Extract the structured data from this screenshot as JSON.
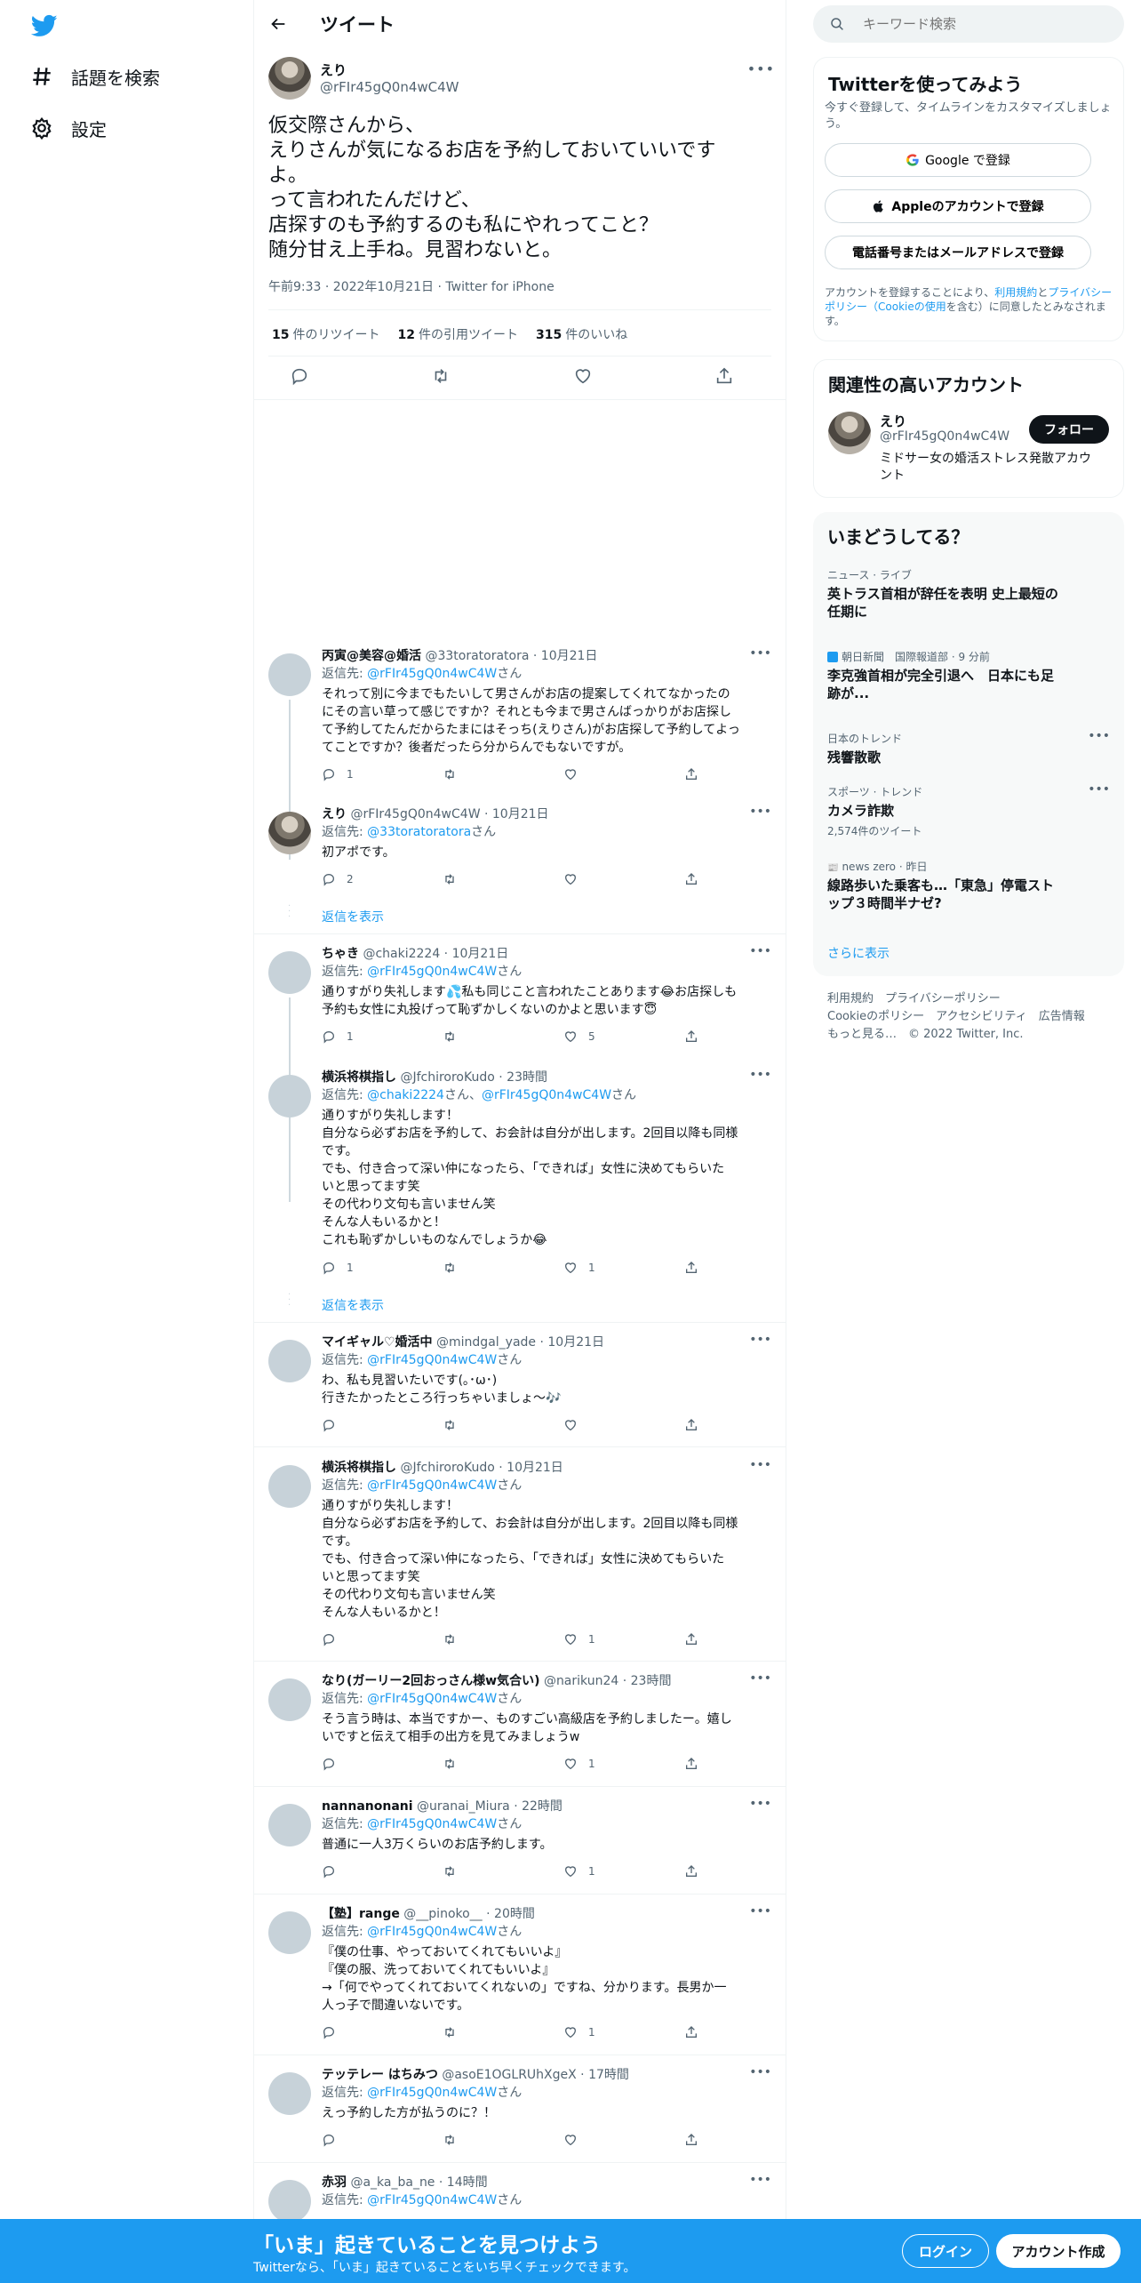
{
  "nav": {
    "explore": "話題を検索",
    "settings": "設定"
  },
  "header": {
    "title": "ツイート"
  },
  "main_tweet": {
    "name": "えり",
    "handle": "@rFIr45gQ0n4wC4W",
    "text": "仮交際さんから、\nえりさんが気になるお店を予約しておいていいです\nよ。\nって言われたんだけど、\n店探すのも予約するのも私にやれってこと？\n随分甘え上手ね。見習わないと。",
    "meta": "午前9:33 · 2022年10月21日 · Twitter for iPhone",
    "stats": [
      {
        "count": "15",
        "label": "件のリツイート"
      },
      {
        "count": "12",
        "label": "件の引用ツイート"
      },
      {
        "count": "315",
        "label": "件のいいね"
      }
    ]
  },
  "replies": [
    {
      "name": "丙寅@美容@婚活",
      "handle": "@33toratoratora",
      "time": "10月21日",
      "to_prefix": "返信先: ",
      "to": "@rFIr45gQ0n4wC4W",
      "to_suffix": "さん",
      "text": "それって別に今までもたいして男さんがお店の提案してくれてなかったの\nにその言い草って感じですか？それとも今まで男さんばっかりがお店探し\nて予約してたんだからたまにはそっち(えりさん)がお店探して予約してよっ\nてことですか？後者だったら分からんでもないですが。",
      "reply": "1",
      "rt": "",
      "like": ""
    },
    {
      "name": "えり",
      "handle": "@rFIr45gQ0n4wC4W",
      "time": "10月21日",
      "to_prefix": "返信先: ",
      "to": "@33toratoratora",
      "to_suffix": "さん",
      "text": "初アポです。",
      "reply": "2",
      "rt": "",
      "like": ""
    },
    {
      "name": "ちゃき",
      "handle": "@chaki2224",
      "time": "10月21日",
      "to_prefix": "返信先: ",
      "to": "@rFIr45gQ0n4wC4W",
      "to_suffix": "さん",
      "text": "通りすがり失礼します💦私も同じこと言われたことあります😂お店探しも\n予約も女性に丸投げって恥ずかしくないのかよと思います😇",
      "reply": "1",
      "rt": "",
      "like": "5"
    },
    {
      "name": "横浜将棋指し",
      "handle": "@JfchiroroKudo",
      "time": "23時間",
      "to_prefix": "返信先: ",
      "to": "@chaki2224",
      "to_mid": "さん、",
      "to2": "@rFIr45gQ0n4wC4W",
      "to_suffix": "さん",
      "text": "通りすがり失礼します！\n自分なら必ずお店を予約して、お会計は自分が出します。2回目以降も同様\nです。\nでも、付き合って深い仲になったら、「できれば」女性に決めてもらいた\nいと思ってます笑\nその代わり文句も言いません笑\nそんな人もいるかと！\nこれも恥ずかしいものなんでしょうか😂",
      "reply": "1",
      "rt": "",
      "like": "1"
    },
    {
      "name": "マイギャル♡婚活中",
      "handle": "@mindgal_yade",
      "time": "10月21日",
      "to_prefix": "返信先: ",
      "to": "@rFIr45gQ0n4wC4W",
      "to_suffix": "さん",
      "text": "わ、私も見習いたいです(｡･ω･)\n行きたかったところ行っちゃいましょ〜🎶",
      "reply": "",
      "rt": "",
      "like": ""
    },
    {
      "name": "横浜将棋指し",
      "handle": "@JfchiroroKudo",
      "time": "10月21日",
      "to_prefix": "返信先: ",
      "to": "@rFIr45gQ0n4wC4W",
      "to_suffix": "さん",
      "text": "通りすがり失礼します！\n自分なら必ずお店を予約して、お会計は自分が出します。2回目以降も同様\nです。\nでも、付き合って深い仲になったら、「できれば」女性に決めてもらいた\nいと思ってます笑\nその代わり文句も言いません笑\nそんな人もいるかと！",
      "reply": "",
      "rt": "",
      "like": "1"
    },
    {
      "name": "なり(ガーリー2回おっさん様w気合い)",
      "handle": "@narikun24",
      "time": "23時間",
      "to_prefix": "返信先: ",
      "to": "@rFIr45gQ0n4wC4W",
      "to_suffix": "さん",
      "text": "そう言う時は、本当ですかー、ものすごい高級店を予約しましたー。嬉し\nいですと伝えて相手の出方を見てみましょうw",
      "reply": "",
      "rt": "",
      "like": "1"
    },
    {
      "name": "nannanonani",
      "handle": "@uranai_Miura",
      "time": "22時間",
      "to_prefix": "返信先: ",
      "to": "@rFIr45gQ0n4wC4W",
      "to_suffix": "さん",
      "text": "普通に一人3万くらいのお店予約します。",
      "reply": "",
      "rt": "",
      "like": "1"
    },
    {
      "name": "【塾】range",
      "handle": "@__pinoko__",
      "time": "20時間",
      "to_prefix": "返信先: ",
      "to": "@rFIr45gQ0n4wC4W",
      "to_suffix": "さん",
      "text": "『僕の仕事、やっておいてくれてもいいよ』\n『僕の服、洗っておいてくれてもいいよ』\n→「何でやってくれておいてくれないの」ですね、分かります。長男か一\n人っ子で間違いないです。",
      "reply": "",
      "rt": "",
      "like": "1"
    },
    {
      "name": "テッテレー はちみつ",
      "handle": "@asoE1OGLRUhXgeX",
      "time": "17時間",
      "to_prefix": "返信先: ",
      "to": "@rFIr45gQ0n4wC4W",
      "to_suffix": "さん",
      "text": "えっ予約した方が払うのに？！",
      "reply": "",
      "rt": "",
      "like": ""
    },
    {
      "name": "赤羽",
      "handle": "@a_ka_ba_ne",
      "time": "14時間",
      "to_prefix": "返信先: ",
      "to": "@rFIr45gQ0n4wC4W",
      "to_suffix": "さん",
      "text": "",
      "reply": "",
      "rt": "",
      "like": ""
    }
  ],
  "show_replies": "返信を表示",
  "search": {
    "placeholder": "キーワード検索"
  },
  "signup_card": {
    "title": "Twitterを使ってみよう",
    "subtitle": "今すぐ登録して、タイムラインをカスタマイズしましょう。",
    "google": "Google で登録",
    "apple": "Appleのアカウントで登録",
    "phone": "電話番号またはメールアドレスで登録",
    "legal_1": "アカウントを登録することにより、",
    "legal_terms": "利用規約",
    "legal_and": "と",
    "legal_privacy": "プライバシーポリシー（Cookieの使用",
    "legal_2": "を含む）に同意したとみなされます。"
  },
  "related": {
    "title": "関連性の高いアカウント",
    "name": "えり",
    "handle": "@rFIr45gQ0n4wC4W",
    "follow": "フォロー",
    "bio": "ミドサー女の婚活ストレス発散アカウ\nント"
  },
  "trends": {
    "title": "いまどうしてる？",
    "items": [
      {
        "cat": "ニュース · ライブ",
        "title": "英トラス首相が辞任を表明 史上最短の任期に",
        "sub": ""
      },
      {
        "cat": "朝日新聞　国際報道部 · 9 分前",
        "title": "李克強首相が完全引退へ　日本にも足跡が...",
        "sub": ""
      },
      {
        "cat": "日本のトレンド",
        "title": "残響散歌",
        "sub": ""
      },
      {
        "cat": "スポーツ · トレンド",
        "title": "カメラ詐欺",
        "sub": "2,574件のツイート"
      },
      {
        "cat": "news zero · 昨日",
        "title": "線路歩いた乗客も…「東急」停電ストップ３時間半ナゼ?",
        "sub": ""
      }
    ],
    "show_more": "さらに表示"
  },
  "footer": {
    "line1": "利用規約　プライバシーポリシー",
    "line2": "Cookieのポリシー　アクセシビリティ　広告情報",
    "line3": "もっと見る…　© 2022 Twitter, Inc."
  },
  "banner": {
    "title": "「いま」起きていることを見つけよう",
    "subtitle": "Twitterなら、「いま」起きていることをいち早くチェックできます。",
    "login": "ログイン",
    "signup": "アカウント作成"
  },
  "colors": {
    "accent": "#1d9bf0",
    "text": "#0f1419",
    "muted": "#536471"
  }
}
